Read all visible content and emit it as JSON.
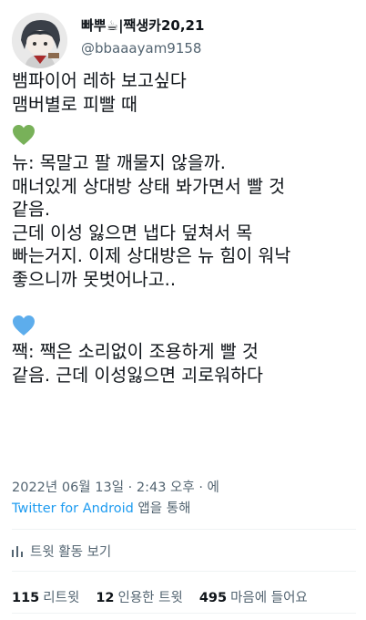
{
  "author": {
    "display_name": "빠뿌",
    "display_name_emoji": "☕",
    "display_name_suffix": "|짹생카20,21",
    "handle": "@bbaaayam9158"
  },
  "tweet": {
    "line1": "뱀파이어 레하 보고싶다",
    "line2": "맴버별로 피빨 때",
    "green_heart_icon": "green-heart",
    "nyu_lines": [
      "뉴: 목말고 팔 깨물지 않을까.",
      "매너있게 상대방 상태 봐가면서 빨 것",
      "같음.",
      "근데 이성 잃으면 냅다 덮쳐서 목",
      "빠는거지. 이제 상대방은 뉴 힘이 워낙",
      "좋으니까 못벗어나고.."
    ],
    "blue_heart_icon": "blue-heart",
    "jjak_lines": [
      "짹: 짹은 소리없이 조용하게 빨 것",
      "같음. 근데 이성잃으면 괴로워하다"
    ]
  },
  "meta": {
    "timestamp": "2022년 06월 13일 · 2:43 오후 · 에",
    "source_app": "Twitter for Android",
    "source_suffix": " 앱을 통해"
  },
  "activity": {
    "label": "트윗 활동 보기",
    "icon": "bar-chart-icon"
  },
  "stats": {
    "retweets_count": "115",
    "retweets_label": "리트윗",
    "quotes_count": "12",
    "quotes_label": "인용한 트윗",
    "likes_count": "495",
    "likes_label": "마음에 들어요"
  },
  "colors": {
    "text_primary": "#0f1419",
    "text_secondary": "#536471",
    "link": "#1d9bf0",
    "heart_green": "#78b159",
    "heart_blue": "#5dadec"
  }
}
